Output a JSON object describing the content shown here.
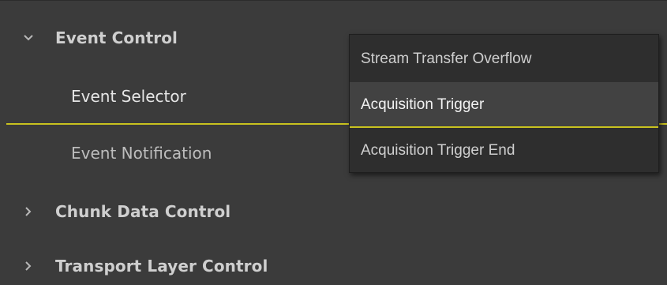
{
  "tree": {
    "groups": [
      {
        "label": "Event Control",
        "icon": "chevron-down-icon"
      },
      {
        "label": "Chunk Data Control",
        "icon": "chevron-right-icon"
      },
      {
        "label": "Transport Layer Control",
        "icon": "chevron-right-icon"
      }
    ],
    "items": [
      {
        "label": "Event Selector"
      },
      {
        "label": "Event Notification"
      }
    ]
  },
  "dropdown": {
    "options": [
      "Stream Transfer Overflow",
      "Acquisition Trigger",
      "Acquisition Trigger End"
    ],
    "highlighted": "Acquisition Trigger"
  },
  "colors": {
    "background": "#3b3b3b",
    "accent": "#c9c21f",
    "dropdown_bg": "#2e2e2e",
    "highlight_bg": "#424242"
  }
}
